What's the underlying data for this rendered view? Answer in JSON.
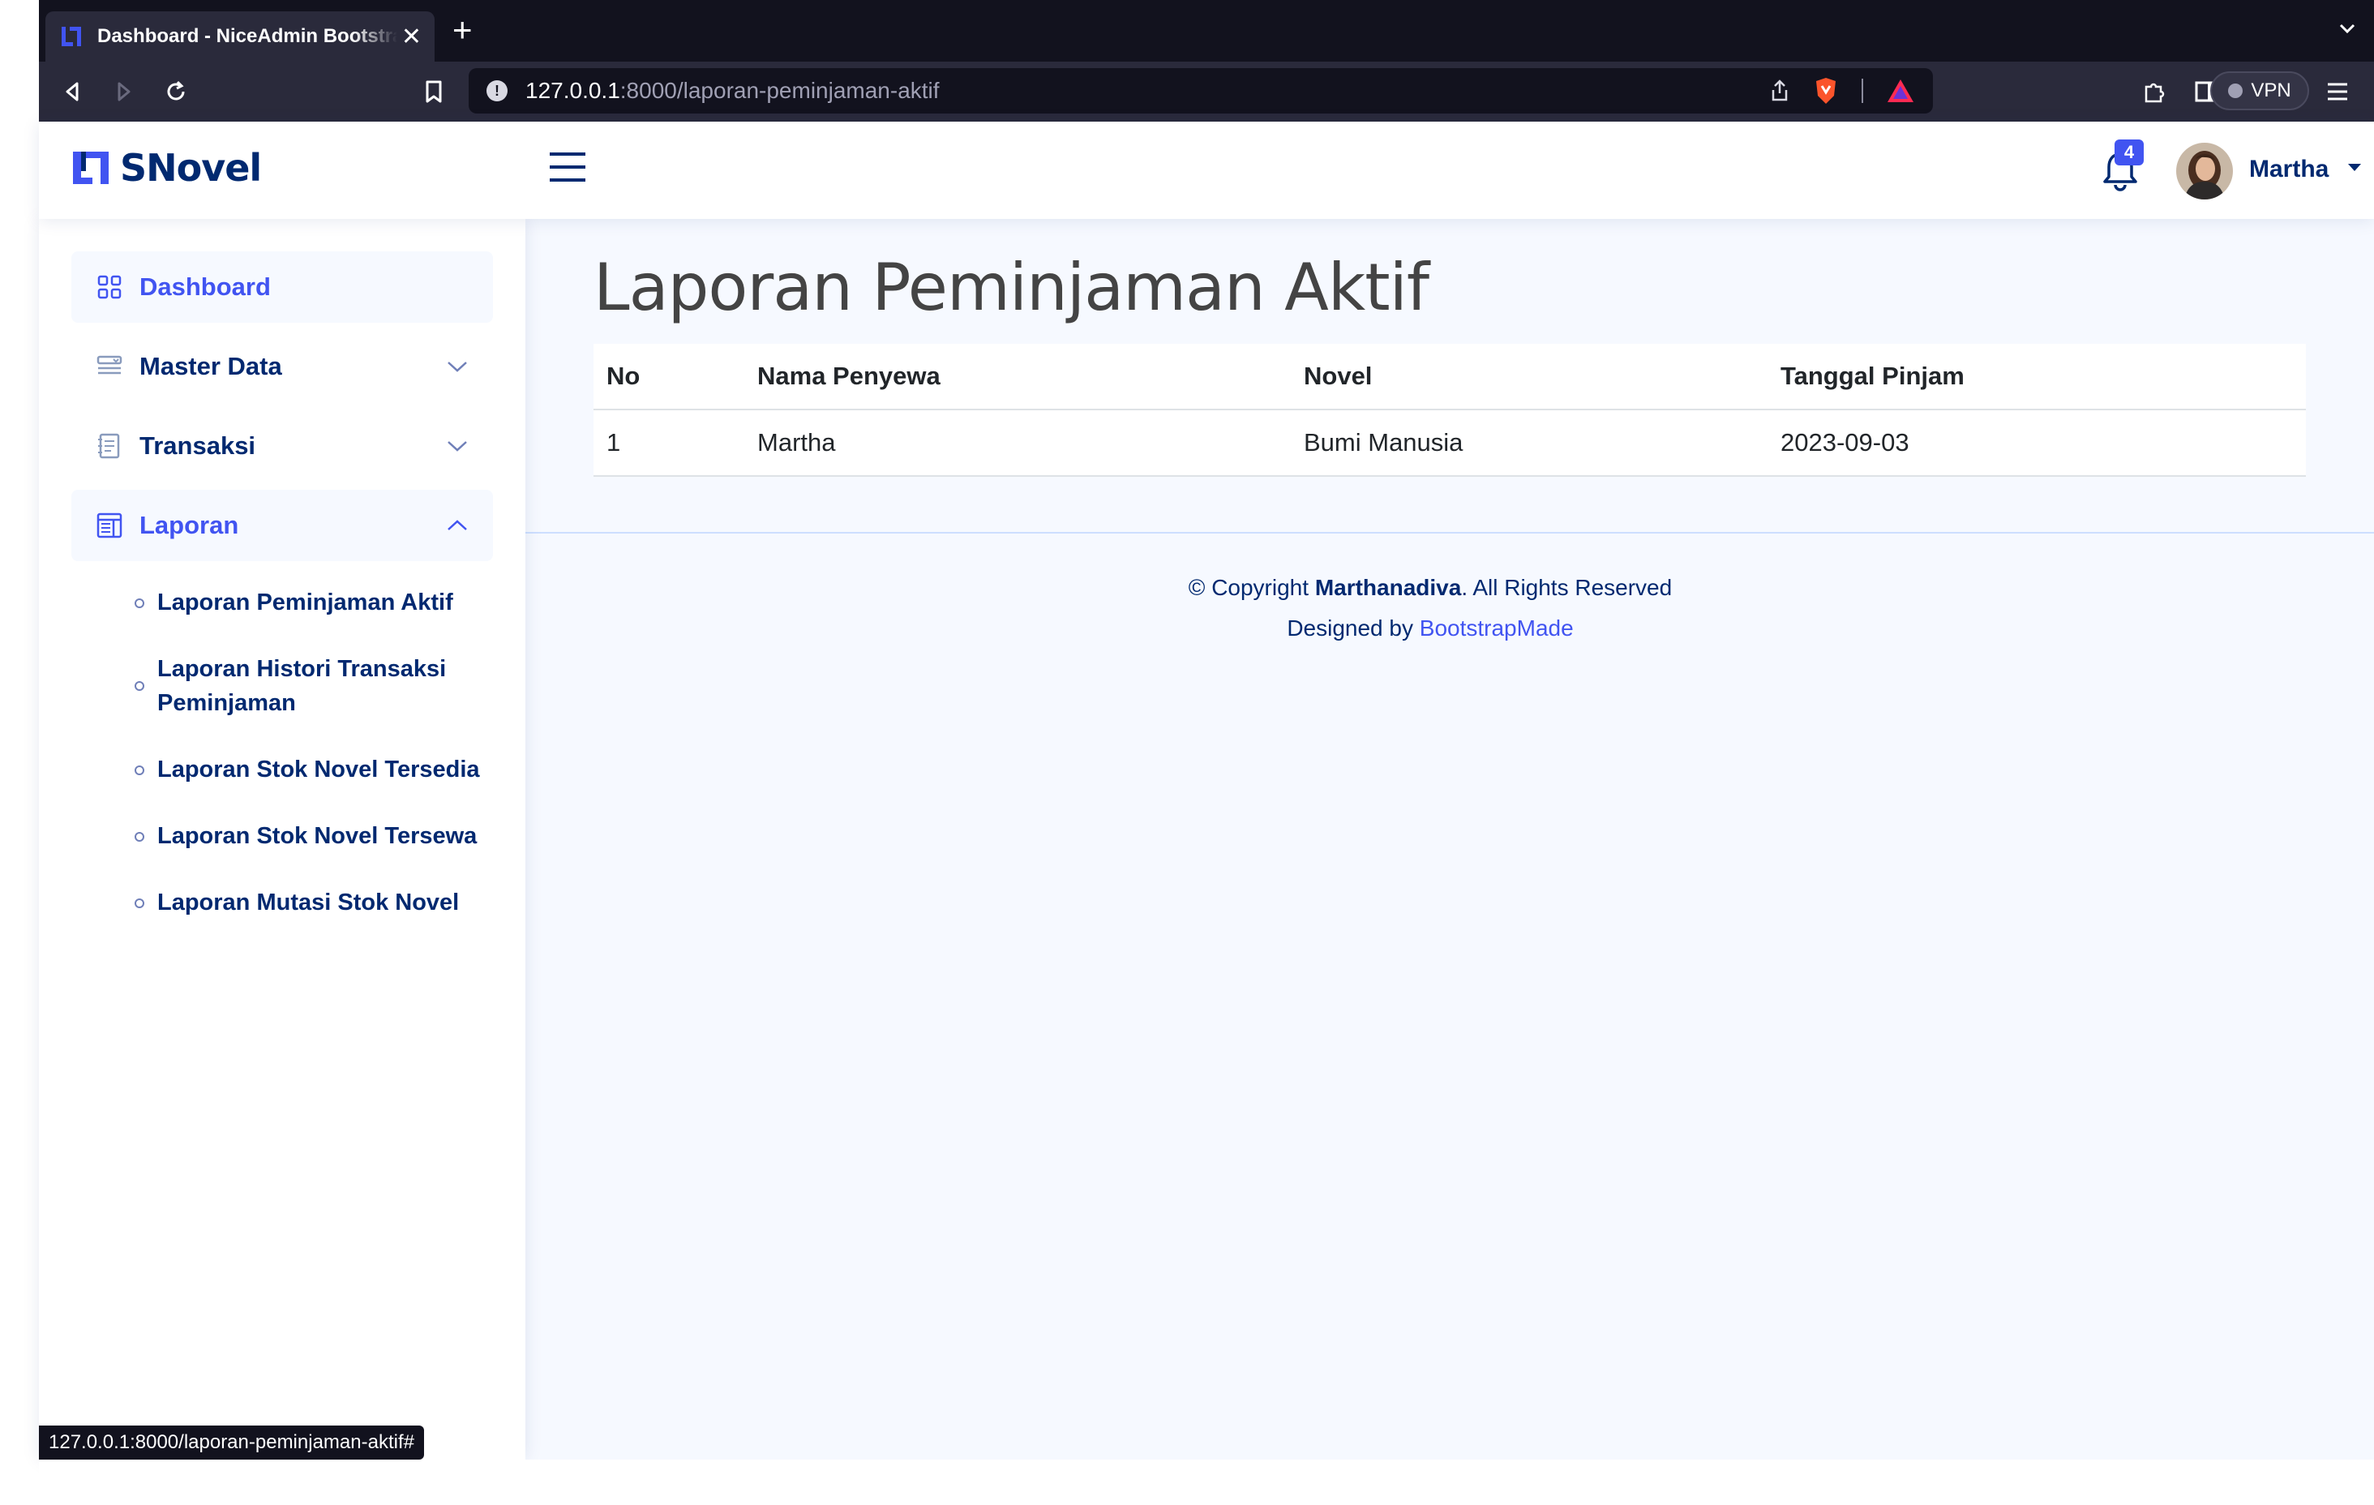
{
  "browser": {
    "tab_title": "Dashboard - NiceAdmin Bootstrap Template",
    "tab_close": "✕",
    "new_tab": "+",
    "address_host": "127.0.0.1",
    "address_path": ":8000/laporan-peminjaman-aktif",
    "vpn_label": "VPN",
    "status_url": "127.0.0.1:8000/laporan-peminjaman-aktif#"
  },
  "header": {
    "brand": "SNovel",
    "notification_count": "4",
    "user_name": "Martha"
  },
  "sidebar": {
    "items": [
      {
        "label": "Dashboard",
        "icon": "grid-icon",
        "active": true
      },
      {
        "label": "Master Data",
        "icon": "menu-button-icon",
        "expandable": true
      },
      {
        "label": "Transaksi",
        "icon": "journal-text-icon",
        "expandable": true
      },
      {
        "label": "Laporan",
        "icon": "layout-text-window-icon",
        "expanded": true
      }
    ],
    "sub_items": [
      {
        "label": "Laporan Peminjaman Aktif"
      },
      {
        "label": "Laporan Histori Transaksi Peminjaman"
      },
      {
        "label": "Laporan Stok Novel Tersedia"
      },
      {
        "label": "Laporan Stok Novel Tersewa"
      },
      {
        "label": "Laporan Mutasi Stok Novel"
      }
    ]
  },
  "main": {
    "title": "Laporan Peminjaman Aktif",
    "table": {
      "headers": [
        "No",
        "Nama Penyewa",
        "Novel",
        "Tanggal Pinjam"
      ],
      "rows": [
        [
          "1",
          "Martha",
          "Bumi Manusia",
          "2023-09-03"
        ]
      ]
    }
  },
  "footer": {
    "copyright_prefix": "© Copyright ",
    "copyright_owner": "Marthanadiva",
    "copyright_suffix": ". All Rights Reserved",
    "designed_by": "Designed by ",
    "designer": "BootstrapMade"
  },
  "colors": {
    "brand": "#012970",
    "accent": "#4154f1",
    "main_bg": "#f6f9ff",
    "browser_dark": "#12121e"
  }
}
